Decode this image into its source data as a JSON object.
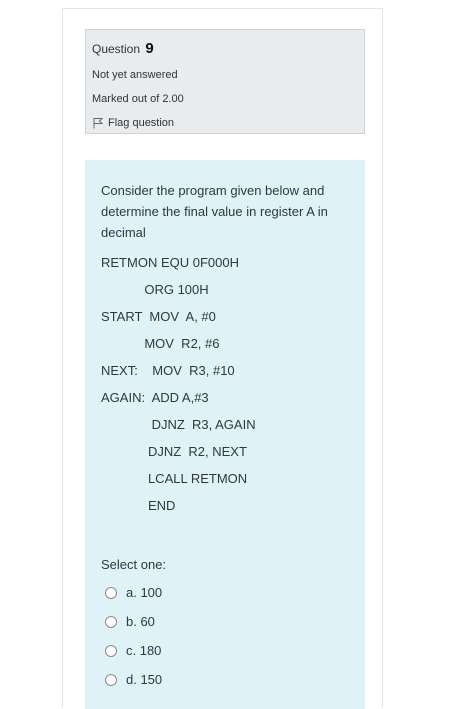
{
  "info": {
    "question_prefix": "Question",
    "question_number": "9",
    "status": "Not yet answered",
    "marks": "Marked out of 2.00",
    "flag_label": "Flag question"
  },
  "question": {
    "text": "Consider the program given below and determine the final value in register A in decimal",
    "code_lines": [
      "RETMON EQU 0F000H",
      "            ORG 100H",
      "START  MOV  A, #0",
      "            MOV  R2, #6",
      "NEXT:    MOV  R3, #10",
      "AGAIN:  ADD A,#3",
      "              DJNZ  R3, AGAIN",
      "             DJNZ  R2, NEXT",
      "             LCALL RETMON",
      "             END"
    ]
  },
  "answer": {
    "prompt": "Select one:",
    "options": [
      "a. 100",
      "b. 60",
      "c. 180",
      "d. 150"
    ]
  }
}
